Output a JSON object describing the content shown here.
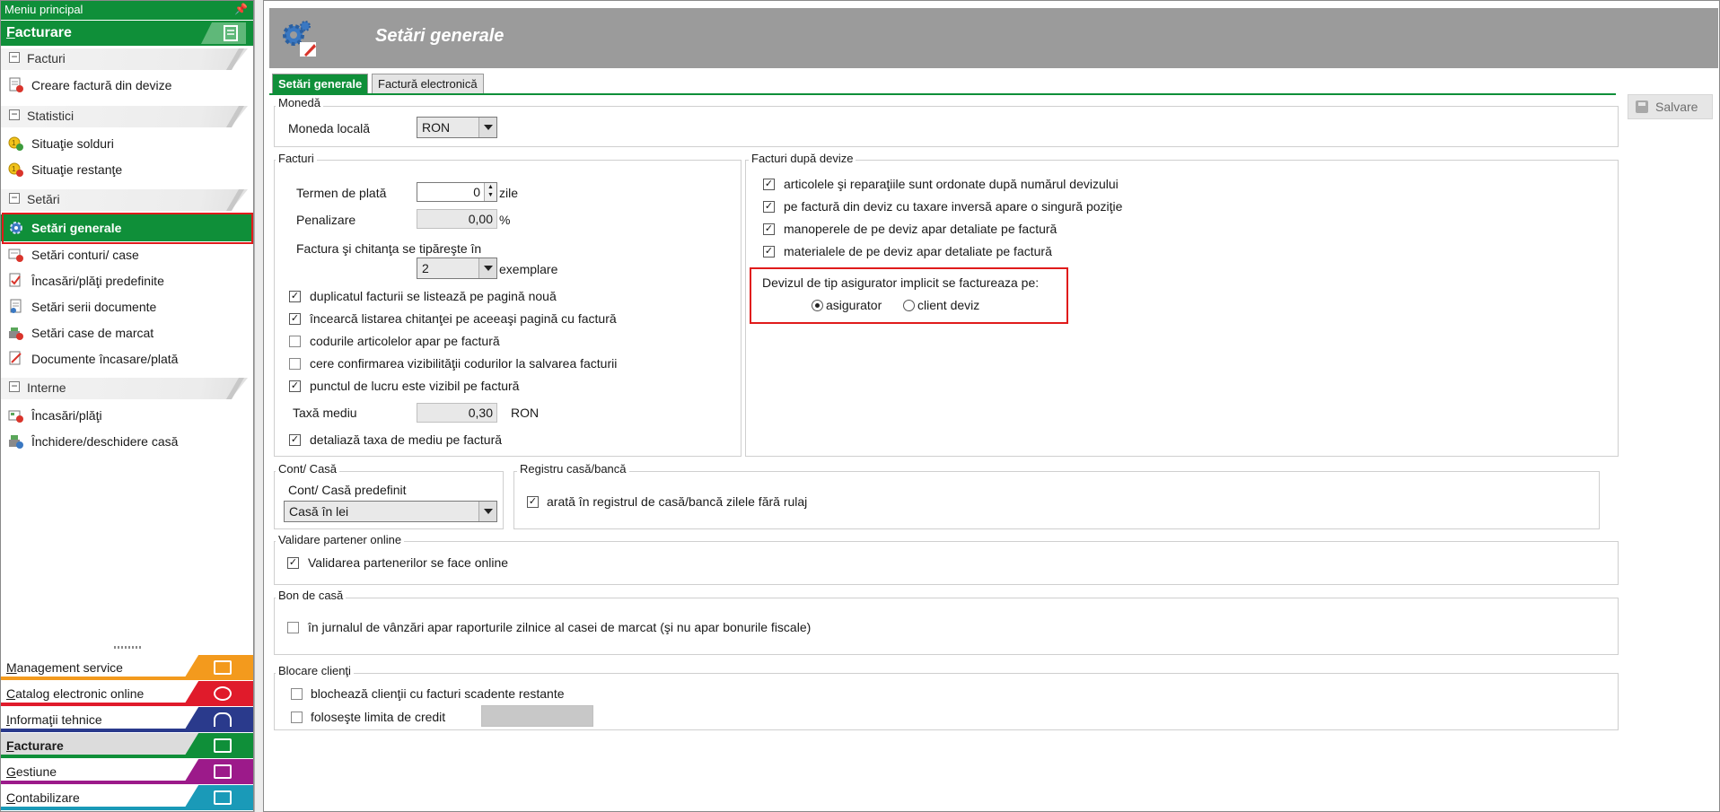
{
  "sidebar": {
    "header": "Meniu principal",
    "pin_icon": "pin-icon",
    "active_module": {
      "label": "Facturare",
      "underline": "F",
      "rest": "acturare"
    },
    "groups": [
      {
        "label": "Facturi",
        "items": [
          {
            "label": "Creare factură din devize",
            "icon": "invoice-create-icon"
          }
        ]
      },
      {
        "label": "Statistici",
        "items": [
          {
            "label": "Situaţie solduri",
            "icon": "balance-coins-icon"
          },
          {
            "label": "Situaţie restanţe",
            "icon": "overdue-coins-icon"
          }
        ]
      },
      {
        "label": "Setări",
        "items": [
          {
            "label": "Setări generale",
            "icon": "gear-icon",
            "active": true
          },
          {
            "label": "Setări conturi/ case",
            "icon": "accounts-settings-icon"
          },
          {
            "label": "Încasări/plăţi predefinite",
            "icon": "payments-predefined-icon"
          },
          {
            "label": "Setări serii documente",
            "icon": "document-series-icon"
          },
          {
            "label": "Setări case de marcat",
            "icon": "cash-register-icon"
          },
          {
            "label": "Documente încasare/plată",
            "icon": "payment-documents-icon"
          }
        ]
      },
      {
        "label": "Interne",
        "items": [
          {
            "label": "Încasări/plăţi",
            "icon": "payments-icon"
          },
          {
            "label": "Închidere/deschidere casă",
            "icon": "cash-register-open-icon"
          }
        ]
      }
    ],
    "modules": [
      {
        "u": "M",
        "rest": "anagement service",
        "color": "#f39a1d"
      },
      {
        "u": "C",
        "rest": "atalog electronic online",
        "color": "#e01b2b"
      },
      {
        "u": "I",
        "rest": "nformaţii tehnice",
        "color": "#2a3a8c"
      },
      {
        "u": "F",
        "rest": "acturare",
        "color": "#0f8f39",
        "active": true
      },
      {
        "u": "G",
        "rest": "estiune",
        "color": "#9c1a8a"
      },
      {
        "u": "C",
        "rest": "ontabilizare",
        "color": "#1a9ab8"
      }
    ]
  },
  "header": {
    "title": "Setări generale",
    "icon": "settings-gears-icon"
  },
  "tabs": [
    "Setări generale",
    "Factură electronică"
  ],
  "save_button": {
    "label": "Salvare",
    "icon": "save-disk-icon"
  },
  "moneda": {
    "title": "Monedă",
    "label": "Moneda locală",
    "value": "RON"
  },
  "facturi": {
    "title": "Facturi",
    "termen_label": "Termen de plată",
    "termen_value": "0",
    "termen_unit": "zile",
    "penalizare_label": "Penalizare",
    "penalizare_value": "0,00",
    "penalizare_unit": "%",
    "tiparire_label": "Factura şi chitanţa se tipăreşte în",
    "tiparire_value": "2",
    "tiparire_unit": "exemplare",
    "checks": [
      {
        "label": "duplicatul facturii se listează pe pagină nouă",
        "checked": true
      },
      {
        "label": "încearcă listarea chitanţei pe aceeaşi pagină cu factură",
        "checked": true
      },
      {
        "label": "codurile articolelor apar pe factură",
        "checked": false
      },
      {
        "label": "cere confirmarea vizibilităţii codurilor la salvarea facturii",
        "checked": false
      },
      {
        "label": "punctul de lucru este vizibil pe factură",
        "checked": true
      }
    ],
    "taxa_label": "Taxă mediu",
    "taxa_value": "0,30",
    "taxa_unit": "RON",
    "detaliaza": {
      "label": "detaliază taxa de mediu pe factură",
      "checked": true
    }
  },
  "facturi_devize": {
    "title": "Facturi după devize",
    "checks": [
      {
        "label": "articolele şi reparaţiile sunt ordonate după numărul devizului",
        "checked": true
      },
      {
        "label": "pe factură din deviz cu taxare inversă apare o singură poziţie",
        "checked": true
      },
      {
        "label": "manoperele de pe deviz apar detaliate pe factură",
        "checked": true
      },
      {
        "label": "materialele de pe deviz apar detaliate pe factură",
        "checked": true
      }
    ],
    "asigurator_label": "Devizul de tip asigurator implicit se factureaza pe:",
    "radio_asigurator": "asigurator",
    "radio_client": "client deviz",
    "selected": "asigurator"
  },
  "cont_casa": {
    "title": "Cont/ Casă",
    "label": "Cont/ Casă predefinit",
    "value": "Casă în lei"
  },
  "registru": {
    "title": "Registru casă/bancă",
    "check": {
      "label": "arată în registrul de casă/bancă zilele fără rulaj",
      "checked": true
    }
  },
  "validare": {
    "title": "Validare partener online",
    "check": {
      "label": "Validarea partenerilor se face online",
      "checked": true
    }
  },
  "bon": {
    "title": "Bon de casă",
    "check": {
      "label": "în jurnalul de vânzări apar raporturile zilnice al casei de marcat (şi nu apar bonurile fiscale)",
      "checked": false
    }
  },
  "blocare": {
    "title": "Blocare clienţi",
    "checks": [
      {
        "label": "blochează clienţii cu facturi scadente restante",
        "checked": false
      },
      {
        "label": "foloseşte limita de credit",
        "checked": false
      }
    ]
  }
}
